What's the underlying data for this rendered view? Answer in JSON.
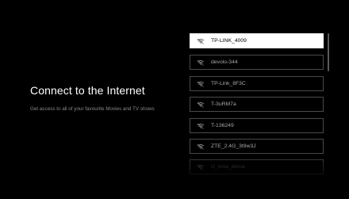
{
  "screen": {
    "title": "Connect to the Internet",
    "subtitle": "Get access to all of your favourite Movies and TV shows"
  },
  "networks": [
    {
      "name": "TP-LINK_4009",
      "selected": true,
      "icon": "wifi-icon"
    },
    {
      "name": "devolo-344",
      "selected": false,
      "icon": "wifi-icon"
    },
    {
      "name": "TP-Link_8F3C",
      "selected": false,
      "icon": "wifi-icon"
    },
    {
      "name": "T-3uRM7a",
      "selected": false,
      "icon": "wifi-icon"
    },
    {
      "name": "T-136249",
      "selected": false,
      "icon": "wifi-icon"
    },
    {
      "name": "ZTE_2.4G_3t9w3J",
      "selected": false,
      "icon": "wifi-icon"
    },
    {
      "name": "U_mna_doma",
      "selected": false,
      "icon": "wifi-icon"
    }
  ],
  "colors": {
    "background": "#000000",
    "selected_bg": "#ffffff",
    "item_border": "#4a4a4a",
    "text_primary": "#ffffff",
    "text_secondary": "#a8a8a8"
  }
}
